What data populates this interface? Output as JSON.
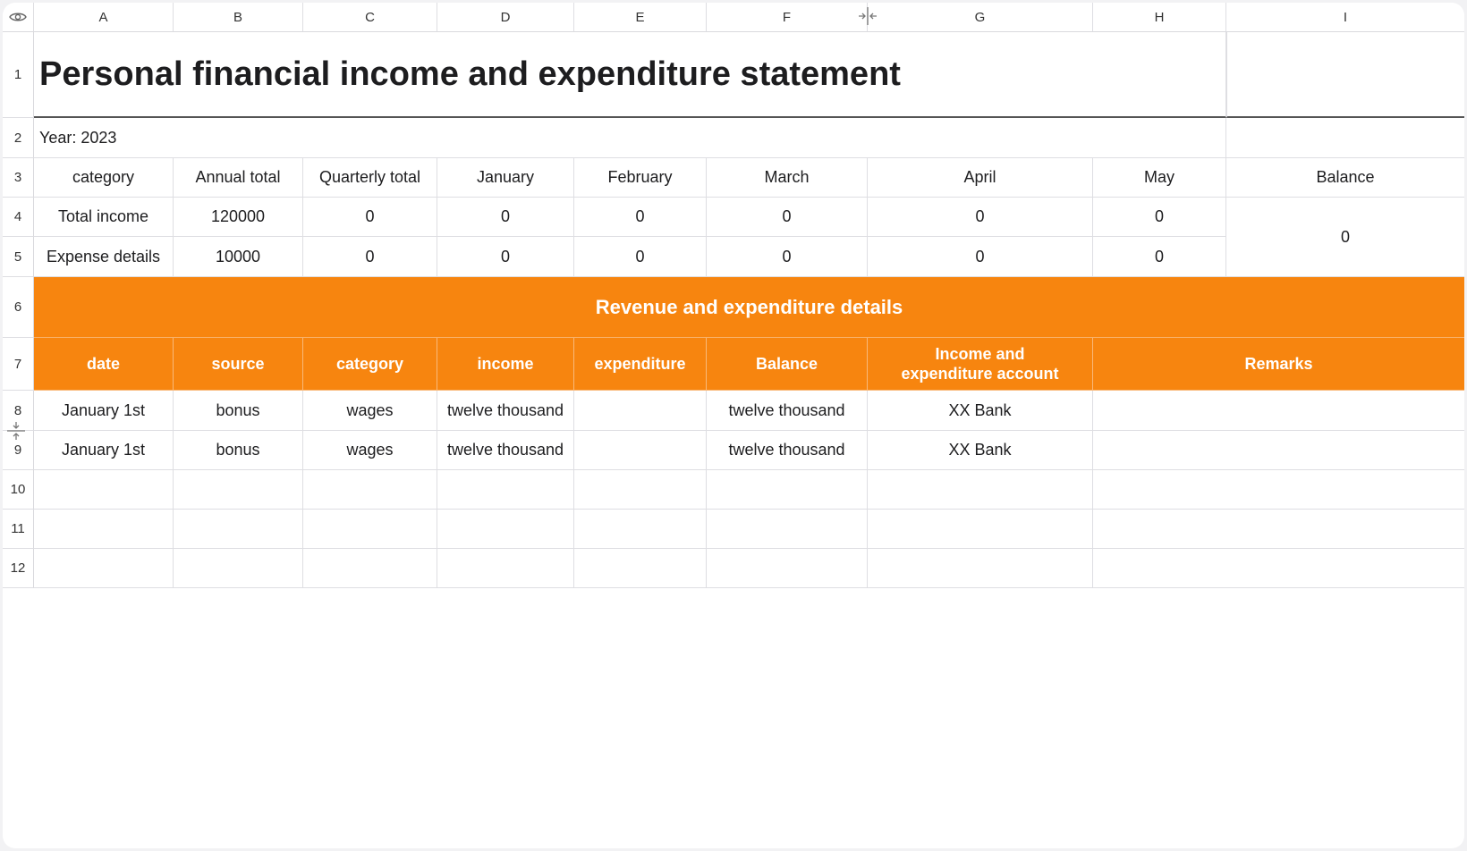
{
  "column_headers": [
    "A",
    "B",
    "C",
    "D",
    "E",
    "F",
    "G",
    "H",
    "I"
  ],
  "row_headers": [
    "1",
    "2",
    "3",
    "4",
    "5",
    "6",
    "7",
    "8",
    "9",
    "10",
    "11",
    "12"
  ],
  "title": "Personal financial income and expenditure statement",
  "year_label": "Year: 2023",
  "summary": {
    "headers": [
      "category",
      "Annual total",
      "Quarterly total",
      "January",
      "February",
      "March",
      "April",
      "May",
      "Balance"
    ],
    "rows": [
      [
        "Total income",
        "120000",
        "0",
        "0",
        "0",
        "0",
        "0",
        "0"
      ],
      [
        "Expense details",
        "10000",
        "0",
        "0",
        "0",
        "0",
        "0",
        "0"
      ]
    ],
    "balance_value": "0"
  },
  "details": {
    "banner": "Revenue and expenditure details",
    "headers": [
      "date",
      "source",
      "category",
      "income",
      "expenditure",
      "Balance",
      "Income and expenditure account",
      "Remarks"
    ],
    "rows": [
      [
        "January 1st",
        "bonus",
        "wages",
        "twelve thousand",
        "",
        "twelve thousand",
        "XX Bank",
        ""
      ],
      [
        "January 1st",
        "bonus",
        "wages",
        "twelve thousand",
        "",
        "twelve thousand",
        "XX Bank",
        ""
      ]
    ]
  },
  "colors": {
    "accent_orange": "#f7850f",
    "grid_line": "#dedee2",
    "title_underline": "#555555"
  },
  "icons": {
    "corner": "eye-icon",
    "column_resize": "column-resize-icon",
    "row_resize": "row-resize-icon"
  }
}
